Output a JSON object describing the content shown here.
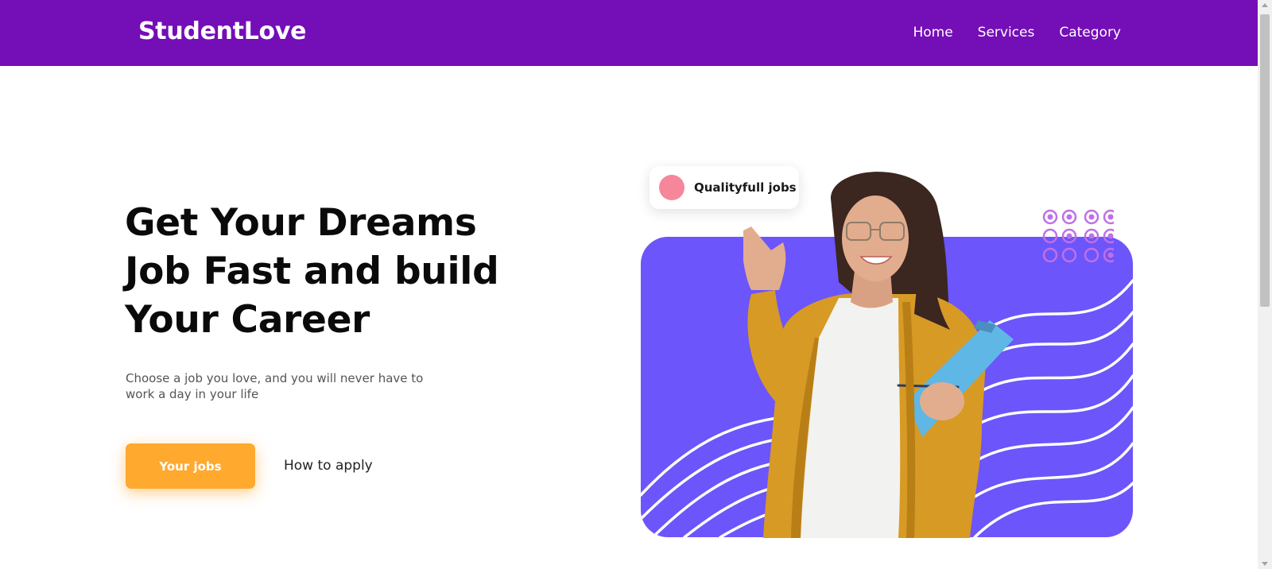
{
  "brand": {
    "name": "StudentLove"
  },
  "nav": {
    "items": [
      {
        "label": "Home"
      },
      {
        "label": "Services"
      },
      {
        "label": "Category"
      }
    ]
  },
  "hero": {
    "title_lines": [
      "Get Your Dreams",
      "Job Fast and build",
      "Your Career"
    ],
    "subtitle_lines": [
      "Choose a job you love, and you will never have to",
      "work a day in your life"
    ],
    "primary_button": "Your jobs",
    "secondary_link": "How to apply"
  },
  "badge": {
    "label": "Qualityfull jobs"
  },
  "colors": {
    "nav_background": "#740eb7",
    "accent_orange": "#ffa92e",
    "card_purple": "#6c55fb",
    "badge_dot": "#f6869a",
    "dots_pattern": "#c070e6"
  },
  "icons": {
    "badge_icon": "pink-dot-icon",
    "decoration": "circle-dots-pattern-icon"
  }
}
